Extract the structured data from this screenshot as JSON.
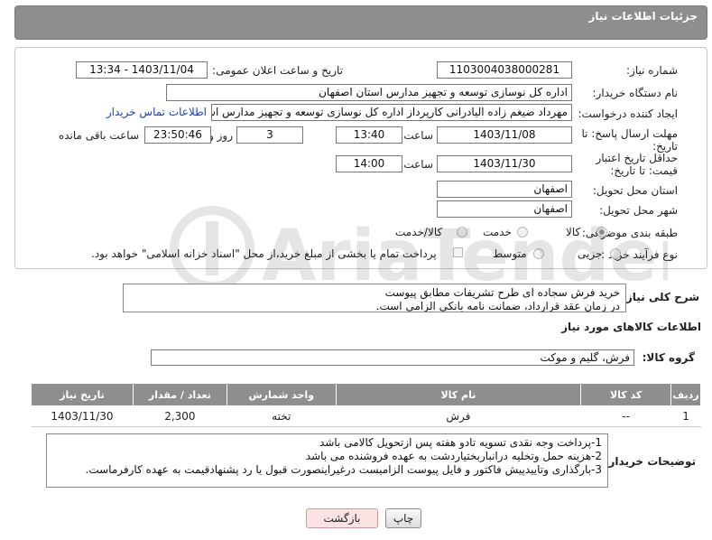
{
  "header": {
    "title": "جزئیات اطلاعات نیاز"
  },
  "form": {
    "need_number_label": "شماره نیاز:",
    "need_number": "1103004038000281",
    "announce_label": "تاریخ و ساعت اعلان عمومی:",
    "announce_value": "1403/11/04 - 13:34",
    "buyer_org_label": "نام دستگاه خریدار:",
    "buyer_org": "اداره کل نوسازی  توسعه و تجهیز مدارس استان اصفهان",
    "creator_label": "ایجاد کننده درخواست:",
    "creator": "مهرداد ضیغم زاده الیادرانی کارپرداز اداره کل نوسازی  توسعه و تجهیز مدارس است",
    "contact_link": "اطلاعات تماس خریدار",
    "deadline_label": "مهلت ارسال پاسخ: تا تاریخ:",
    "deadline_date": "1403/11/08",
    "time_label": "ساعت",
    "deadline_time": "13:40",
    "days_value": "3",
    "days_label": "روز و",
    "remaining_time": "23:50:46",
    "remaining_label": "ساعت باقی مانده",
    "validity_label": "حداقل تاریخ اعتبار قیمت: تا تاریخ:",
    "validity_date": "1403/11/30",
    "validity_time": "14:00",
    "province_label": "استان محل تحویل:",
    "province": "اصفهان",
    "city_label": "شهر محل تحویل:",
    "city": "اصفهان",
    "category_label": "طبقه بندی موضوعی:",
    "category_options": [
      "کالا",
      "خدمت",
      "کالا/خدمت"
    ],
    "process_label": "نوع فرآیند خرید :",
    "process_options": [
      "جزیی",
      "متوسط"
    ],
    "payment_note": "پرداخت تمام یا بخشی از مبلغ خرید،از محل \"اسناد خزانه اسلامی\" خواهد بود."
  },
  "description": {
    "label": "شرح کلی نیاز:",
    "text": "خرید فرش سجاده ای طرح تشریفات مطابق پیوست\nدر زمان عقد قرارداد، ضمانت نامه بانکی الزامی است."
  },
  "goods": {
    "title": "اطلاعات کالاهای مورد نیاز",
    "group_label": "گروه کالا:",
    "group_value": "فرش، گلیم و موکت",
    "columns": [
      "ردیف",
      "کد کالا",
      "نام کالا",
      "واحد شمارش",
      "تعداد / مقدار",
      "تاریخ نیاز"
    ],
    "rows": [
      [
        "1",
        "--",
        "فرش",
        "تخته",
        "2,300",
        "1403/11/30"
      ]
    ]
  },
  "buyer_notes": {
    "label": "توضیحات خریدار:",
    "text": "1-پرداخت وجه نقدی تسویه تادو هفته پس ازتحویل کالامی باشد\n2-هزینه حمل وتخلیه درانباربختیاردشت به عهده فروشنده می باشد\n3-بارگذاری وتاییدپیش فاکتور و فایل پیوست الزامیست درغیراینصورت قبول یا رد پشنهادقیمت به عهده کارفرماست."
  },
  "buttons": {
    "print": "چاپ",
    "back": "بازگشت"
  },
  "watermark": "AriaTender.neT"
}
